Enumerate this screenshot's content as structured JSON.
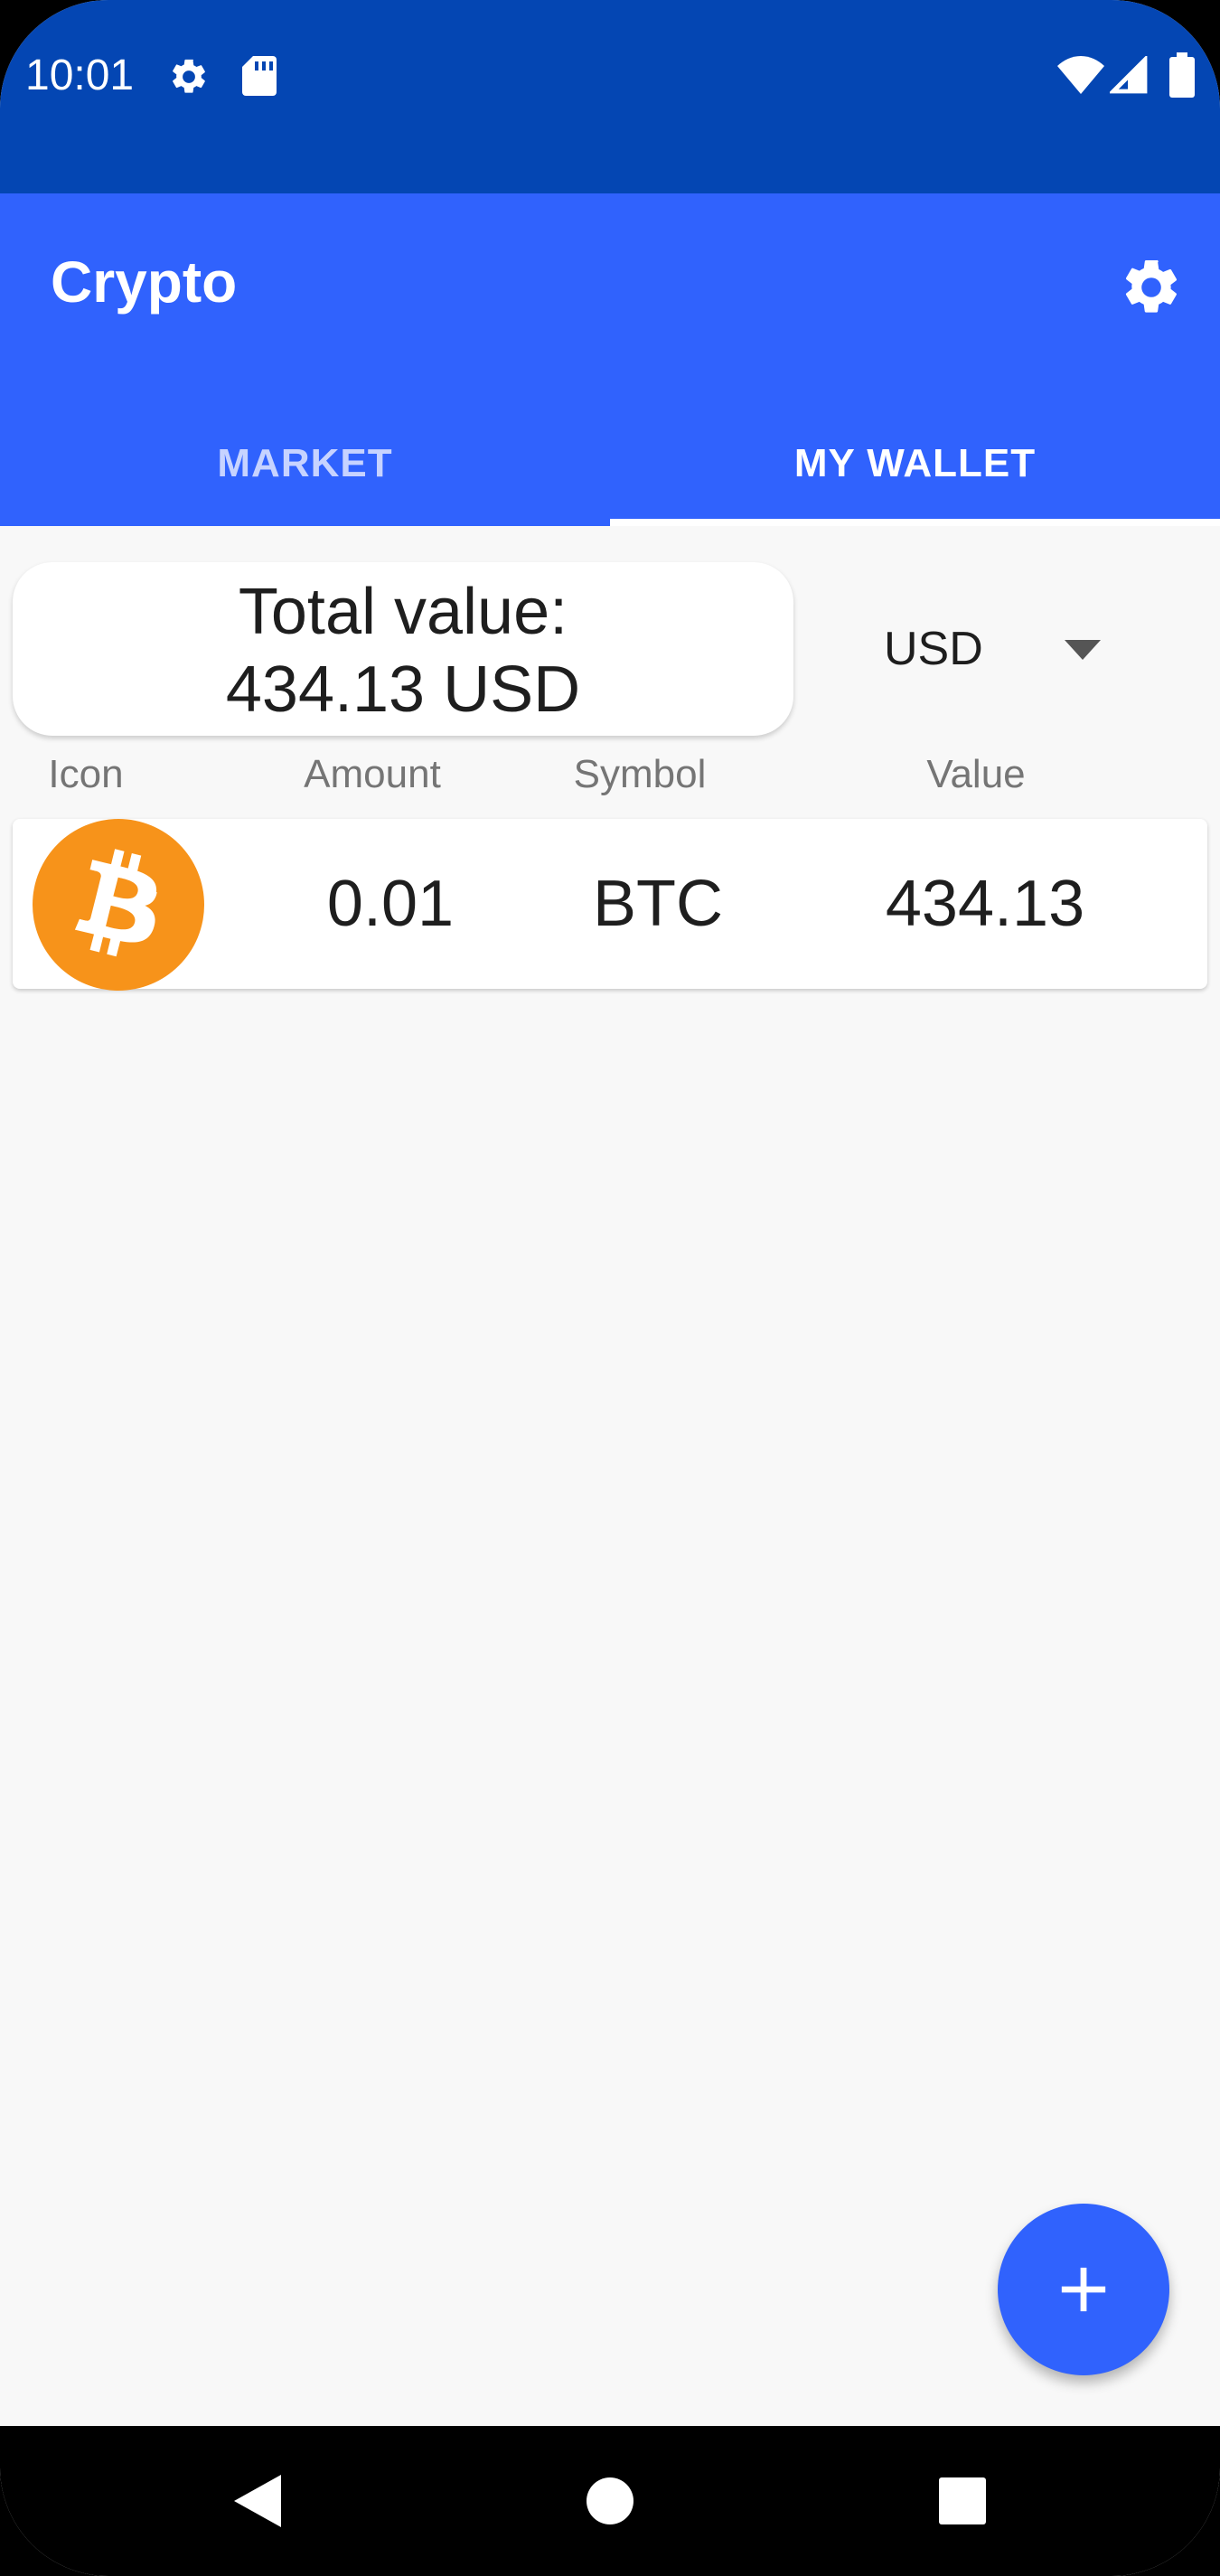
{
  "status_bar": {
    "time": "10:01",
    "icons": [
      "gear-icon",
      "sd-card-icon",
      "wifi-icon",
      "signal-icon",
      "battery-icon"
    ]
  },
  "app_bar": {
    "title": "Crypto",
    "settings_icon": "gear-icon",
    "color": "#3062fd"
  },
  "tabs": [
    {
      "label": "MARKET",
      "selected": false
    },
    {
      "label": "MY WALLET",
      "selected": true
    }
  ],
  "summary": {
    "total_label": "Total value:",
    "total_value": "434.13 USD"
  },
  "currency": {
    "selected": "USD"
  },
  "table": {
    "headers": [
      "Icon",
      "Amount",
      "Symbol",
      "Value"
    ],
    "rows": [
      {
        "icon": "bitcoin-icon",
        "amount": "0.01",
        "symbol": "BTC",
        "value": "434.13"
      }
    ]
  },
  "fab": {
    "icon": "plus-icon"
  },
  "nav": {
    "icons": [
      "back-icon",
      "home-icon",
      "recents-icon"
    ]
  },
  "colors": {
    "status_bar": "#0446b3",
    "accent": "#3062fd",
    "bitcoin": "#f7931a"
  }
}
